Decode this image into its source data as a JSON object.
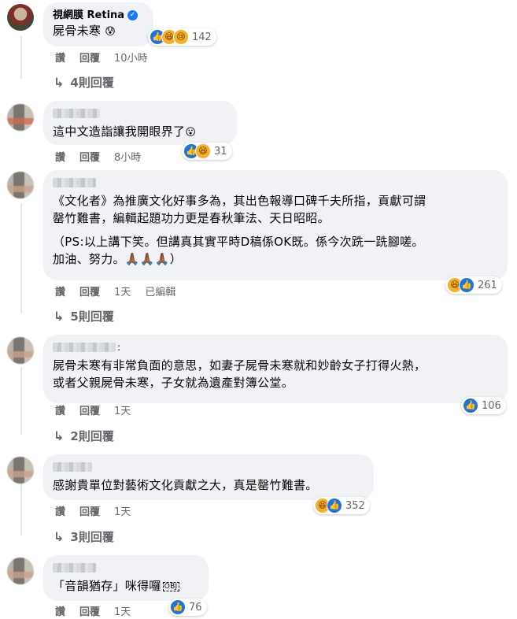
{
  "comments": [
    {
      "author": "視網膜 Retina",
      "verified": true,
      "text": "屍骨未寒",
      "text_emoji": "😰",
      "actions": {
        "like": "讚",
        "reply": "回覆",
        "time": "10小時"
      },
      "reactions": {
        "icons": [
          "like-icon",
          "haha-icon",
          "sad-icon"
        ],
        "count": "142"
      },
      "replies": "4則回覆"
    },
    {
      "author": "",
      "text": "這中文造詣讓我開眼界了",
      "text_emoji": "😮",
      "actions": {
        "like": "讚",
        "reply": "回覆",
        "time": "8小時"
      },
      "reactions": {
        "icons": [
          "like-icon",
          "haha-icon"
        ],
        "count": "31"
      }
    },
    {
      "author": "",
      "text": "《文化者》為推廣文化好事多為，其出色報導口碑千夫所指，貢獻可謂\n罄竹難書，編輯起題功力更是春秋筆法、天日昭昭。",
      "text2": "（PS:以上講下笑。但講真其實平時D稿係OK既。係今次跣一跣腳嗟。\n加油、努力。🙏🏾🙏🏾🙏🏾）",
      "actions": {
        "like": "讚",
        "reply": "回覆",
        "time": "1天",
        "edited": "已編輯"
      },
      "reactions": {
        "icons": [
          "haha-icon",
          "like-icon"
        ],
        "count": "261"
      },
      "replies": "5則回覆"
    },
    {
      "author": "",
      "author_suffix": ":",
      "text": "屍骨未寒有非常負面的意思，如妻子屍骨未寒就和妙齡女子打得火熱，\n或者父親屍骨未寒，子女就為遺產對簿公堂。",
      "actions": {
        "like": "讚",
        "reply": "回覆",
        "time": "1天"
      },
      "reactions": {
        "icons": [
          "like-icon"
        ],
        "count": "106"
      },
      "replies": "2則回覆"
    },
    {
      "author": "",
      "text": "感謝貴單位對藝術文化貢獻之大，真是罄竹難書。",
      "actions": {
        "like": "讚",
        "reply": "回覆",
        "time": "1天"
      },
      "reactions": {
        "icons": [
          "haha-icon",
          "like-icon"
        ],
        "count": "352"
      },
      "replies": "3則回覆"
    },
    {
      "author": "",
      "text": "「音韻猶存」咪得囉",
      "text_emoji": "OBJ",
      "actions": {
        "like": "讚",
        "reply": "回覆",
        "time": "1天"
      },
      "reactions": {
        "icons": [
          "like-icon"
        ],
        "count": "76"
      }
    }
  ],
  "colors": {
    "like": "#1b74e4",
    "haha": "#f7b125",
    "bubble": "#f0f2f5",
    "meta": "#65676b"
  }
}
